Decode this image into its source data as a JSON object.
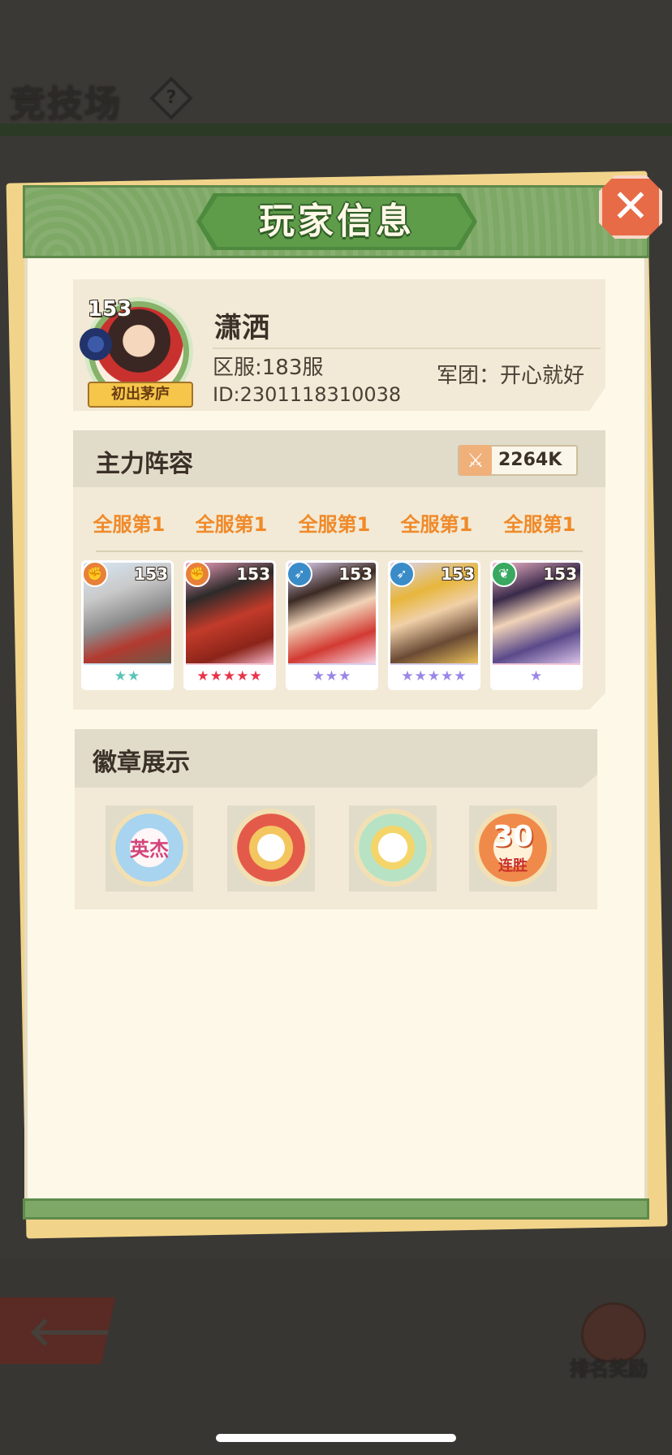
{
  "background": {
    "arena_title": "竞技场",
    "help_icon": "?",
    "back_icon": "🡐",
    "reward_label": "排名奖励"
  },
  "dialog": {
    "title": "玩家信息",
    "close_icon": "✕"
  },
  "player": {
    "level": "153",
    "name": "潇洒",
    "title_badge": "初出茅庐",
    "server": "区服:183服",
    "id": "ID:2301118310038",
    "guild": "军团：开心就好"
  },
  "lineup": {
    "title": "主力阵容",
    "power_icon": "⚔",
    "power": "2264K",
    "heroes": [
      {
        "rank": "全服第1",
        "level": "153",
        "class_icon": "fist-icon",
        "stars": "★★",
        "star_color": "#5ac4b8"
      },
      {
        "rank": "全服第1",
        "level": "153",
        "class_icon": "fist-icon",
        "stars": "★★★★★",
        "star_color": "#e8344a"
      },
      {
        "rank": "全服第1",
        "level": "153",
        "class_icon": "bow-icon",
        "stars": "★★★",
        "star_color": "#9a86e6"
      },
      {
        "rank": "全服第1",
        "level": "153",
        "class_icon": "bow-icon",
        "stars": "★★★★★",
        "star_color": "#9a86e6"
      },
      {
        "rank": "全服第1",
        "level": "153",
        "class_icon": "leaf-icon",
        "stars": "★",
        "star_color": "#9a86e6"
      }
    ]
  },
  "badges": {
    "title": "徽章展示",
    "items": [
      {
        "name": "hero-badge",
        "text": "英杰"
      },
      {
        "name": "dice-badge",
        "text": ""
      },
      {
        "name": "dragon-badge",
        "text": ""
      },
      {
        "name": "streak-badge",
        "text": "30",
        "subtext": "连胜"
      }
    ]
  }
}
